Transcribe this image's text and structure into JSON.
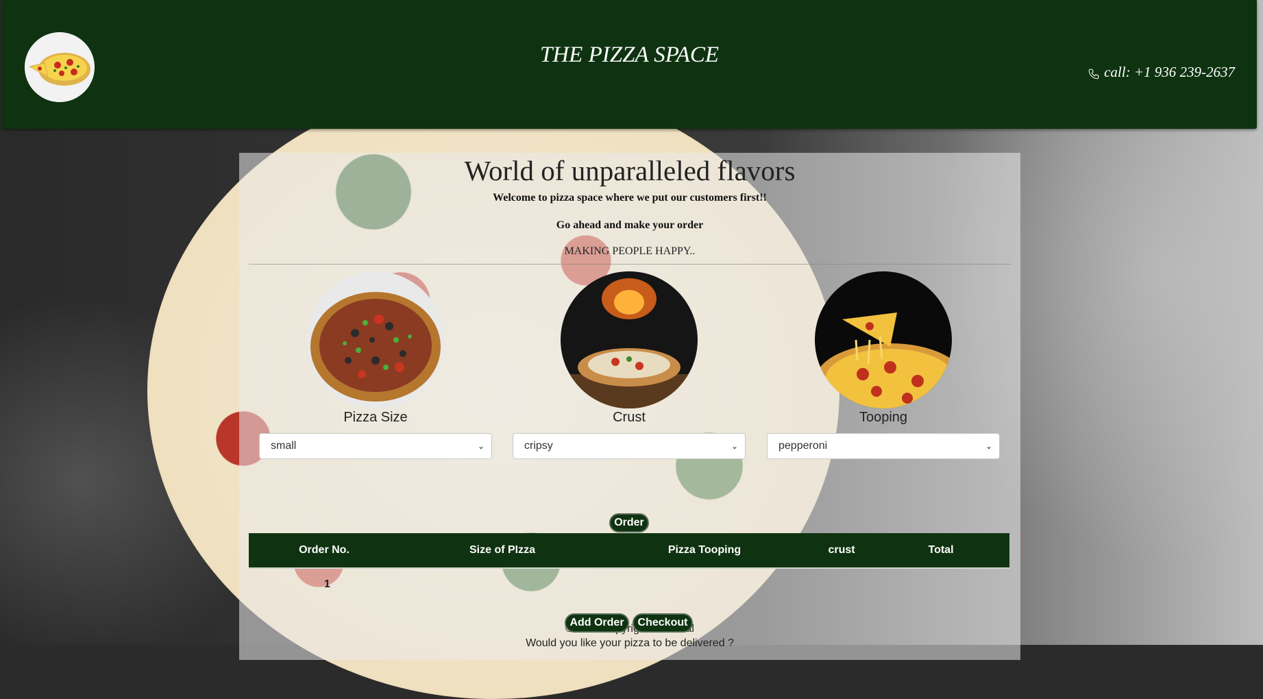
{
  "header": {
    "site_title": "THE PIZZA SPACE",
    "phone_text": "call: +1 936 239-2637"
  },
  "hero": {
    "headline": "World of unparalleled flavors",
    "welcome": "Welcome to pizza space where we put our customers first!!",
    "prompt": "Go ahead and make your order",
    "tagline": "MAKING PEOPLE HAPPY.."
  },
  "options": [
    {
      "label": "Pizza Size",
      "selected": "small"
    },
    {
      "label": "Crust",
      "selected": "cripsy"
    },
    {
      "label": "Tooping",
      "selected": "pepperoni"
    }
  ],
  "buttons": {
    "order": "Order",
    "add_order": "Add Order",
    "checkout": "Checkout"
  },
  "table": {
    "headers": [
      "Order No.",
      "Size of PIzza",
      "Pizza Tooping",
      "crust",
      "Total"
    ],
    "rows": [
      {
        "order_no": "1",
        "size": "",
        "topping": "",
        "crust": "",
        "total": ""
      }
    ]
  },
  "footer": {
    "copyright": "© 2021 copyright Phoenial",
    "delivery_question": "Would you like your pizza to be delivered ?"
  },
  "colors": {
    "brand_green": "#0f3311",
    "panel": "rgba(235,235,235,0.55)"
  }
}
